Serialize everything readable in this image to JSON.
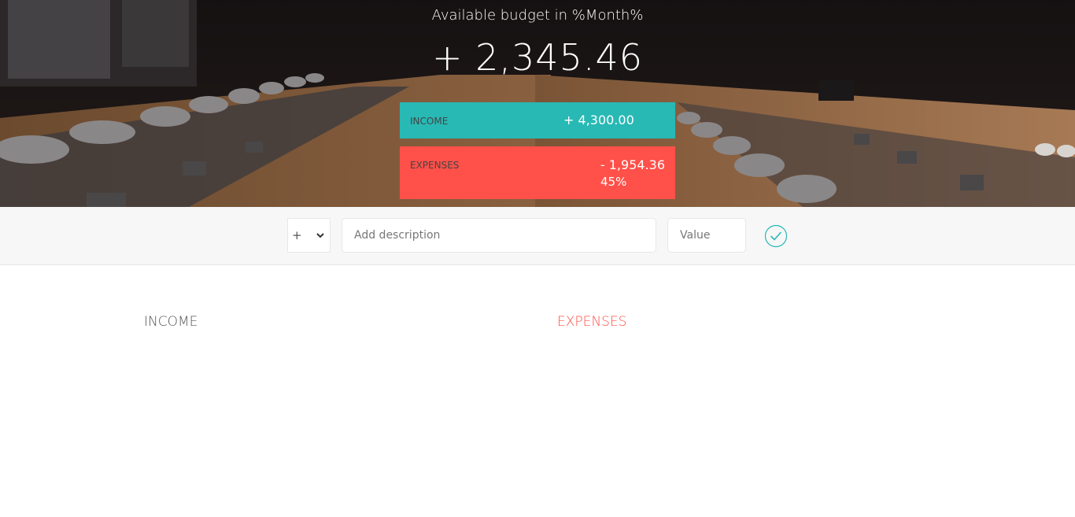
{
  "budget": {
    "title": "Available budget in %Month%",
    "value": "+ 2,345.46"
  },
  "summary": {
    "income": {
      "label": "Income",
      "value": "+ 4,300.00"
    },
    "expenses": {
      "label": "Expenses",
      "value": "- 1,954.36",
      "percentage": "45%"
    }
  },
  "add": {
    "type_selected": "+",
    "description_placeholder": "Add description",
    "value_placeholder": "Value",
    "submit_icon": "check-circle-icon"
  },
  "lists": {
    "income_title": "Income",
    "expenses_title": "Expenses"
  },
  "colors": {
    "income": "#28b9b5",
    "expenses": "#ff5049"
  }
}
